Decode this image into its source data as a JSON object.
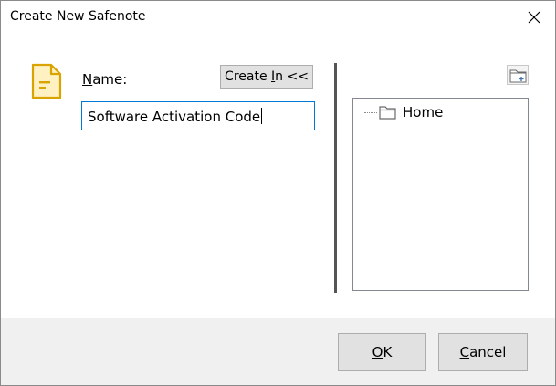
{
  "window": {
    "title": "Create New Safenote"
  },
  "form": {
    "name_label_mnemonic": "N",
    "name_label_rest": "ame:",
    "name_value": "Software Activation Code",
    "create_in_prefix": "Create ",
    "create_in_mnemonic": "I",
    "create_in_suffix": "n <<"
  },
  "tree": {
    "items": [
      {
        "label": "Home",
        "icon": "folder-icon"
      }
    ]
  },
  "footer": {
    "ok_mnemonic": "O",
    "ok_rest": "K",
    "cancel_mnemonic": "C",
    "cancel_rest": "ancel"
  },
  "icons": {
    "note": "safenote-document-icon",
    "close": "close-icon",
    "new_folder": "new-folder-icon"
  },
  "colors": {
    "note_icon_stroke": "#d9a300",
    "note_icon_fill": "#fff1c2",
    "input_focus_border": "#0078d7"
  }
}
